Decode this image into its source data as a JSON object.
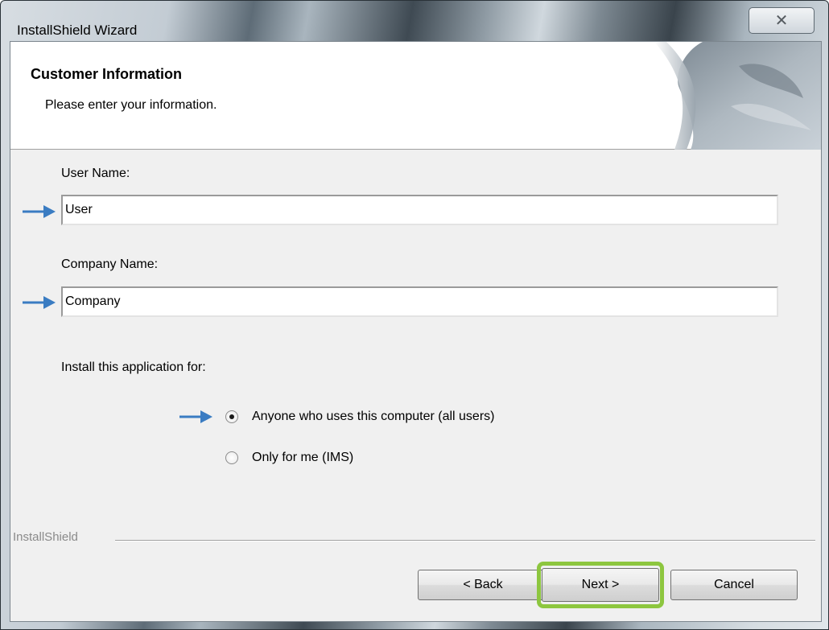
{
  "window": {
    "title": "InstallShield Wizard",
    "close_glyph": "☒"
  },
  "header": {
    "title": "Customer Information",
    "subtitle": "Please enter your information."
  },
  "form": {
    "user_label": "User Name:",
    "user_value": "User",
    "company_label": "Company Name:",
    "company_value": "Company",
    "install_label": "Install this application for:",
    "options": [
      {
        "label": "Anyone who uses this computer (all users)",
        "selected": true
      },
      {
        "label": "Only for me (IMS)",
        "selected": false
      }
    ]
  },
  "footer": {
    "brand": "InstallShield"
  },
  "buttons": {
    "back": "< Back",
    "next": "Next >",
    "cancel": "Cancel"
  },
  "colors": {
    "arrow": "#3a7cc2",
    "highlight": "#8dc63f"
  },
  "icons": [
    "close-icon",
    "arrow-right-icon",
    "radio-icon"
  ]
}
